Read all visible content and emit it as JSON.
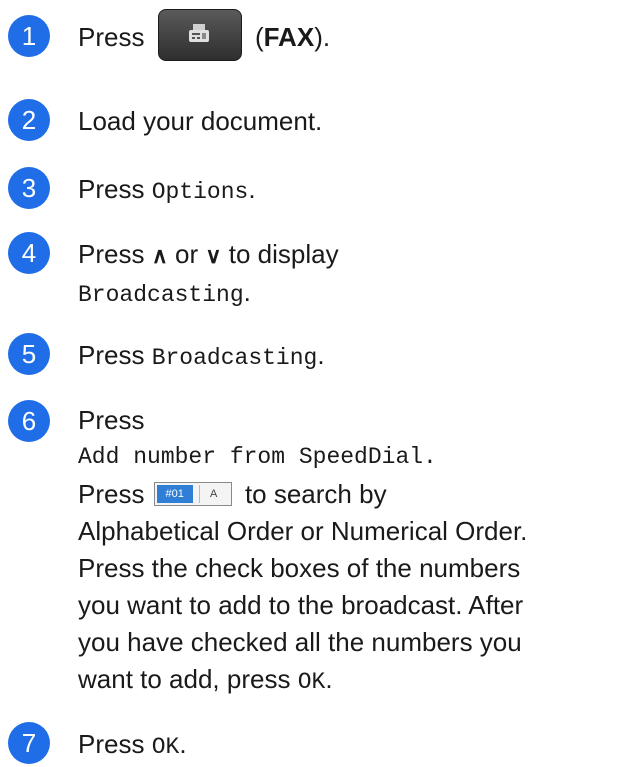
{
  "steps": [
    {
      "num": "1",
      "press": "Press",
      "fax_open": "(",
      "fax": "FAX",
      "fax_close": ")."
    },
    {
      "num": "2",
      "text": "Load your document."
    },
    {
      "num": "3",
      "press": "Press",
      "option": "Options",
      "end": "."
    },
    {
      "num": "4",
      "press": "Press",
      "up_glyph": "∧",
      "or": "or",
      "down_glyph": "∨",
      "to_display": "to display",
      "option": "Broadcasting",
      "end": "."
    },
    {
      "num": "5",
      "press": "Press",
      "option": "Broadcasting",
      "end": "."
    },
    {
      "num": "6",
      "press": "Press",
      "option": "Add number from SpeedDial.",
      "press2": "Press",
      "search_num": "#01",
      "search_alpha": "A",
      "search_text": "to search by",
      "line4": "Alphabetical Order or Numerical Order.",
      "line5": "Press the check boxes of the numbers",
      "line6": "you want to add to the broadcast. After",
      "line7": "you have checked all the numbers you",
      "line8": "want to add, press",
      "ok": "OK",
      "end": "."
    },
    {
      "num": "7",
      "press": "Press",
      "ok": "OK",
      "end": "."
    }
  ],
  "colors": {
    "badge": "#1f6ee8",
    "fax_button": "#3d3d3d"
  }
}
